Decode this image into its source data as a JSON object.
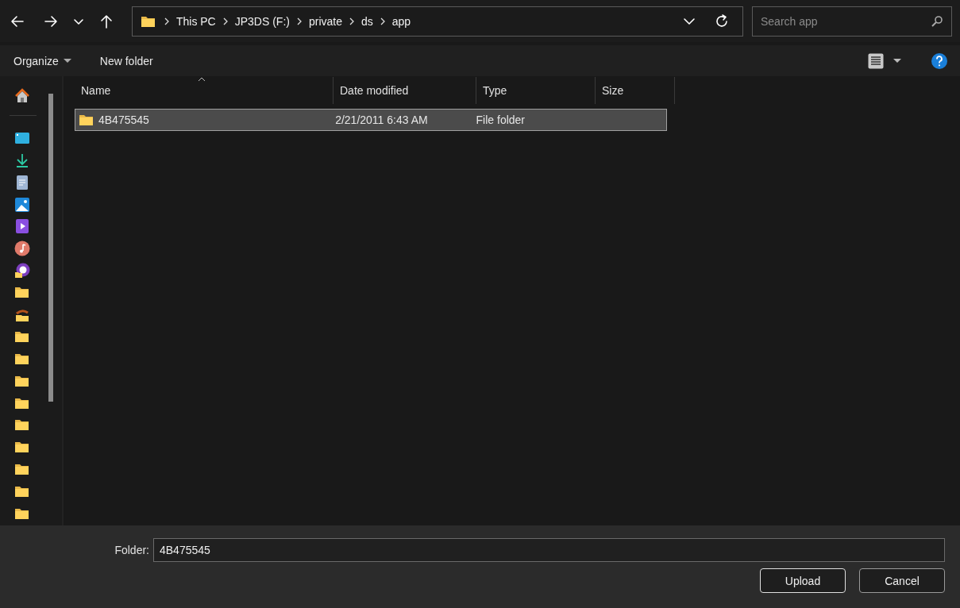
{
  "address_bar": {
    "path": [
      "This PC",
      "JP3DS (F:)",
      "private",
      "ds",
      "app"
    ]
  },
  "search": {
    "placeholder": "Search app"
  },
  "toolbar": {
    "organize": "Organize",
    "new_folder": "New folder"
  },
  "table": {
    "columns": [
      {
        "label": "Name",
        "sorted": true
      },
      {
        "label": "Date modified",
        "sorted": false
      },
      {
        "label": "Type",
        "sorted": false
      },
      {
        "label": "Size",
        "sorted": false
      }
    ],
    "rows": [
      {
        "name": "4B475545",
        "date_modified": "2/21/2011 6:43 AM",
        "type": "File folder",
        "size": "",
        "selected": true
      }
    ]
  },
  "footer": {
    "folder_label": "Folder:",
    "folder_value": "4B475545",
    "buttons": [
      {
        "label": "Upload",
        "kind": "primary"
      },
      {
        "label": "Cancel",
        "kind": "secondary"
      }
    ]
  }
}
